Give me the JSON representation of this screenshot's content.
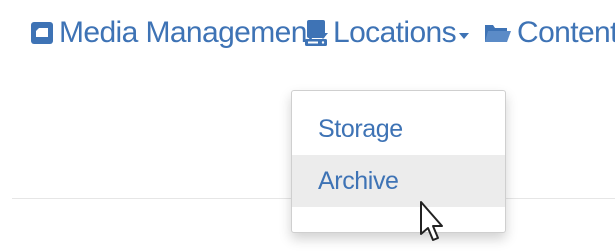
{
  "nav": {
    "items": [
      {
        "label": "Media Management",
        "icon": "media-icon"
      },
      {
        "label": "Locations",
        "icon": "server-icon"
      },
      {
        "label": "Content",
        "icon": "folder-open-icon"
      }
    ]
  },
  "dropdown": {
    "items": [
      {
        "label": "Storage"
      },
      {
        "label": "Archive",
        "state": "hovered"
      }
    ]
  },
  "colors": {
    "link": "#3e73b5",
    "hover_bg": "#ececec"
  }
}
